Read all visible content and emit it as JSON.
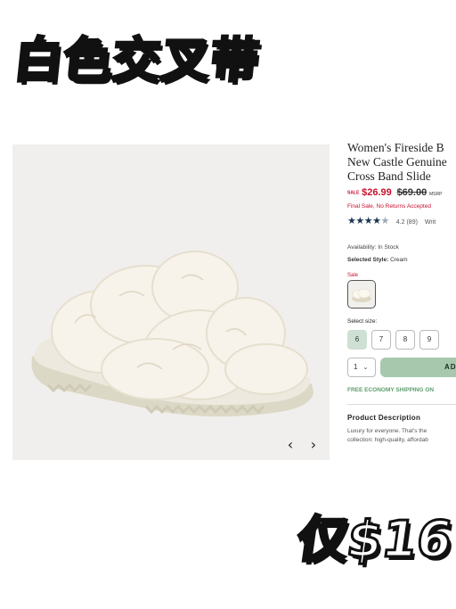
{
  "overlay": {
    "headline": "白色交叉带",
    "price_callout": "仅$16"
  },
  "gallery": {
    "prev_glyph": "‹",
    "next_glyph": "›"
  },
  "product": {
    "title_lines": [
      "Women's Fireside B",
      "New Castle Genuine",
      "Cross Band Slide"
    ],
    "sale_tag": "SALE",
    "sale_price": "$26.99",
    "original_price": "$69.00",
    "msrp_label": "MSRP",
    "final_sale_note": "Final Sale, No Returns Accepted",
    "rating_value": 4.2,
    "rating_text": "4.2",
    "review_count": "(89)",
    "write_review_label": "Writ",
    "availability_label": "Availability:",
    "availability_value": "In Stock",
    "selected_style_label": "Selected Style:",
    "selected_style_value": "Cream",
    "swatch_sale_label": "Sale",
    "select_size_label": "Select size:",
    "sizes": [
      "6",
      "7",
      "8",
      "9"
    ],
    "selected_size": "6",
    "quantity": "1",
    "add_to_cart_label": "ADD",
    "shipping_banner": "FREE ECONOMY SHIPPING ON",
    "description_heading": "Product Description",
    "description_lines": [
      "Luxury for everyone. That's the",
      "collection: high-quality, affordab"
    ]
  },
  "colors": {
    "sale_red": "#c8102e",
    "star_navy": "#1a3553",
    "add_button_green": "#a8c8ae",
    "shipping_green": "#5e9c6f",
    "selected_size_bg": "#cde0d3"
  }
}
